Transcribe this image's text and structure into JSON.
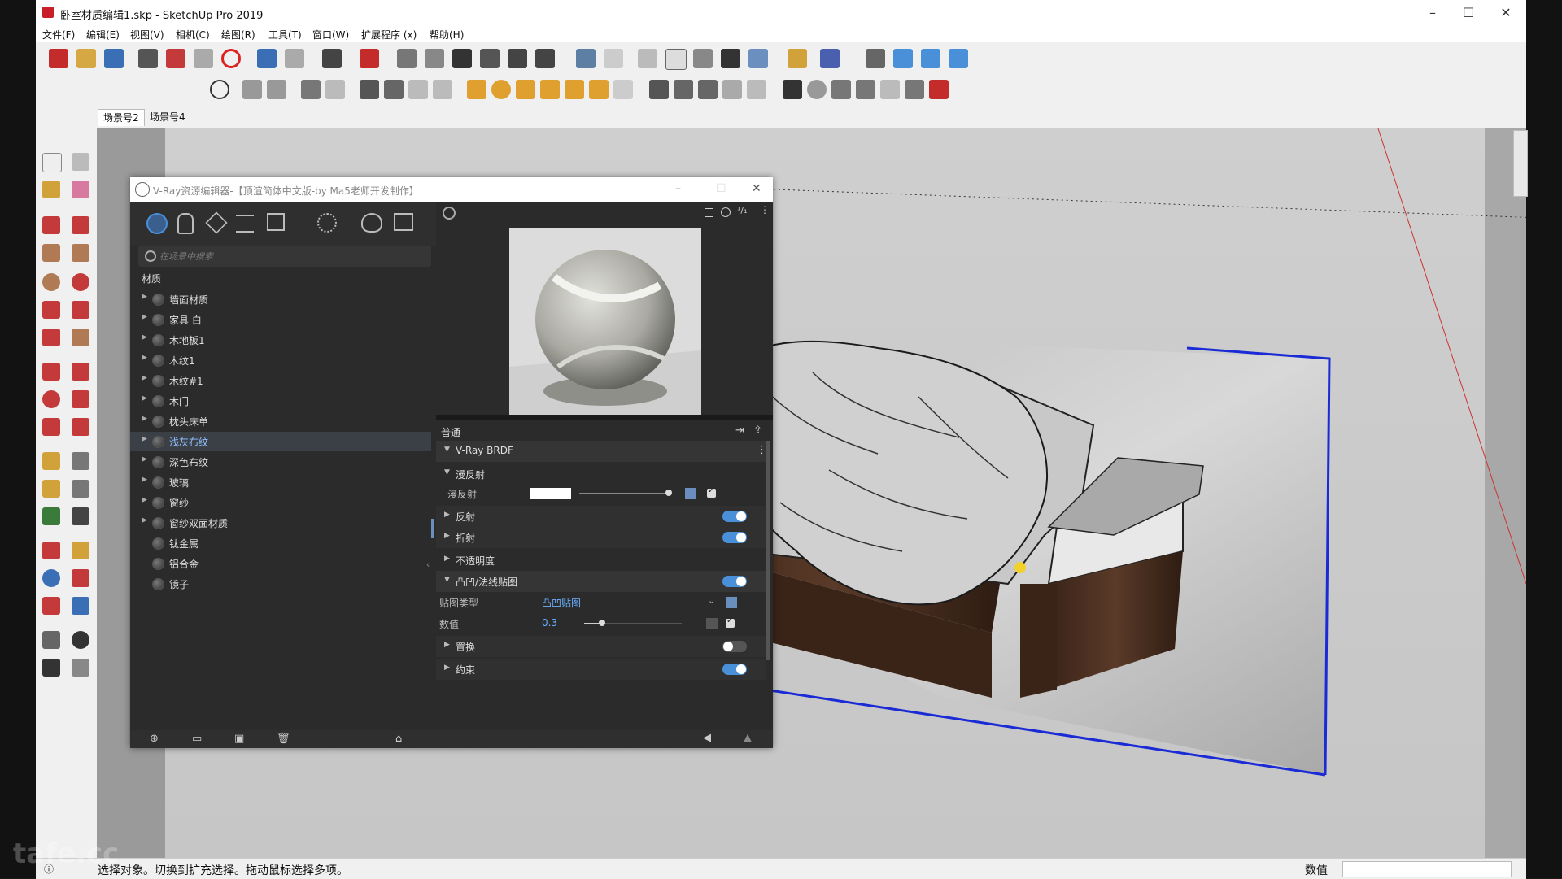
{
  "window": {
    "title": "卧室材质编辑1.skp - SketchUp Pro 2019"
  },
  "menu": [
    "文件(F)",
    "编辑(E)",
    "视图(V)",
    "相机(C)",
    "绘图(R)",
    "工具(T)",
    "窗口(W)",
    "扩展程序 (x)",
    "帮助(H)"
  ],
  "scene_tabs": [
    "场景号2",
    "场景号4"
  ],
  "status": {
    "message": "选择对象。切换到扩充选择。拖动鼠标选择多项。",
    "value_label": "数值",
    "value": ""
  },
  "vray": {
    "title": "V-Ray资源编辑器-【顶渲简体中文版-by Ma5老师开发制作】",
    "search_placeholder": "在场景中搜索",
    "materials_header": "材质",
    "materials": [
      {
        "name": "墙面材质",
        "expandable": true
      },
      {
        "name": "家具 白",
        "expandable": true
      },
      {
        "name": "木地板1",
        "expandable": true
      },
      {
        "name": "木纹1",
        "expandable": true
      },
      {
        "name": "木纹#1",
        "expandable": true
      },
      {
        "name": "木门",
        "expandable": true
      },
      {
        "name": "枕头床单",
        "expandable": true
      },
      {
        "name": "浅灰布纹",
        "expandable": true,
        "selected": true
      },
      {
        "name": "深色布纹",
        "expandable": true
      },
      {
        "name": "玻璃",
        "expandable": true
      },
      {
        "name": "窗纱",
        "expandable": true
      },
      {
        "name": "窗纱双面材质",
        "expandable": true
      },
      {
        "name": "钛金属",
        "expandable": false
      },
      {
        "name": "铝合金",
        "expandable": false
      },
      {
        "name": "镜子",
        "expandable": false
      }
    ],
    "props": {
      "section": "普通",
      "brdf": "V-Ray BRDF",
      "diffuse_group": "漫反射",
      "diffuse_label": "漫反射",
      "reflection": "反射",
      "refraction": "折射",
      "opacity": "不透明度",
      "bump": "凸凹/法线贴图",
      "map_type_label": "贴图类型",
      "map_type_value": "凸凹贴图",
      "amount_label": "数值",
      "amount_value": "0.3",
      "displacement": "置换",
      "binding": "约束",
      "toggles": {
        "reflection": true,
        "refraction": true,
        "bump": true,
        "displacement": false,
        "binding": true
      }
    }
  },
  "watermark": "tafe.cc"
}
